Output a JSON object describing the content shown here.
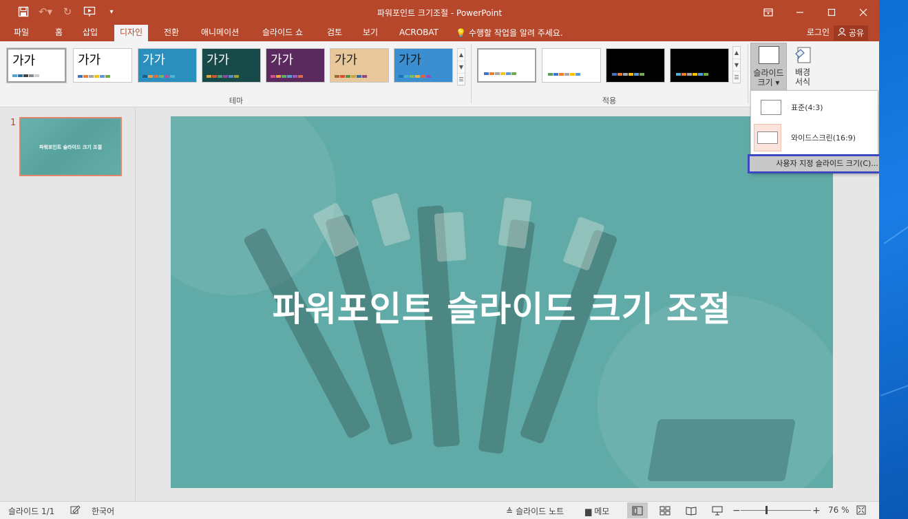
{
  "app": {
    "title": "파워포인트 크기조절 - PowerPoint",
    "accent": "#b7472a"
  },
  "qat": {
    "save_icon": "save-icon",
    "undo_icon": "undo-icon",
    "redo_icon": "redo-icon",
    "present_icon": "present-from-start-icon",
    "customize_icon": "customize-qat-icon"
  },
  "window_controls": {
    "ribbon_display": "ribbon-display-options-icon",
    "minimize": "minimize-icon",
    "maximize": "maximize-icon",
    "close": "close-icon"
  },
  "tabs": [
    {
      "label": "파일"
    },
    {
      "label": "홈"
    },
    {
      "label": "삽입"
    },
    {
      "label": "디자인"
    },
    {
      "label": "전환"
    },
    {
      "label": "애니메이션"
    },
    {
      "label": "슬라이드 쇼"
    },
    {
      "label": "검토"
    },
    {
      "label": "보기"
    },
    {
      "label": "ACROBAT"
    }
  ],
  "tell_me": "수행할 작업을 알려 주세요.",
  "login": "로그인",
  "share": "공유",
  "ribbon": {
    "themes_group_label": "테마",
    "variants_group_label": "적용",
    "themes": [
      {
        "sample": "가가",
        "bg": "#ffffff",
        "fg": "#000000",
        "colors": [
          "#5aa0c8",
          "#2e6f96",
          "#444444",
          "#888888",
          "#cccccc"
        ]
      },
      {
        "sample": "가가",
        "bg": "#ffffff",
        "fg": "#000000",
        "colors": [
          "#4472c4",
          "#ed7d31",
          "#a5a5a5",
          "#ffc000",
          "#5b9bd5",
          "#70ad47"
        ]
      },
      {
        "sample": "가가",
        "bg": "#2a8fbd",
        "fg": "#ffffff",
        "colors": [
          "#1e5f8a",
          "#f2a03d",
          "#e86b3a",
          "#6cb86a",
          "#c04d9a",
          "#4fb5d8"
        ]
      },
      {
        "sample": "가가",
        "bg": "#194a4a",
        "fg": "#ffffff",
        "colors": [
          "#d9a540",
          "#c85a3c",
          "#4d9c7a",
          "#8a4d9c",
          "#5a8cc8",
          "#a0a040"
        ]
      },
      {
        "sample": "가가",
        "bg": "#5a2a5e",
        "fg": "#ffffff",
        "colors": [
          "#d94f8e",
          "#e8a33d",
          "#5bb35b",
          "#4aa3d9",
          "#9a5cc4",
          "#e06a3c"
        ]
      },
      {
        "sample": "가가",
        "bg": "#e8c79a",
        "fg": "#222222",
        "colors": [
          "#9c6a3a",
          "#d94f3a",
          "#5a8c4a",
          "#c8a43a",
          "#3a6a9c",
          "#8a4a7a"
        ]
      },
      {
        "sample": "가가",
        "bg": "#3b8fd0",
        "fg": "#1a1a1a",
        "colors": [
          "#1e72b8",
          "#44b0c8",
          "#7ac04a",
          "#f2b33a",
          "#e8603a",
          "#9a4ab8"
        ]
      }
    ],
    "variants": [
      {
        "bg": "#ffffff",
        "colors": [
          "#4472c4",
          "#ed7d31",
          "#a5a5a5",
          "#ffc000",
          "#5b9bd5",
          "#70ad47"
        ]
      },
      {
        "bg": "#ffffff",
        "colors": [
          "#5a9e5a",
          "#4472c4",
          "#ed7d31",
          "#a5a5a5",
          "#ffc000",
          "#5b9bd5"
        ]
      },
      {
        "bg": "#000000",
        "colors": [
          "#4472c4",
          "#ed7d31",
          "#a5a5a5",
          "#ffc000",
          "#5b9bd5",
          "#70ad47"
        ]
      },
      {
        "bg": "#000000",
        "colors": [
          "#5aaad2",
          "#ed7d31",
          "#a5a5a5",
          "#ffc000",
          "#5b9bd5",
          "#70ad47"
        ]
      }
    ],
    "slide_size_label_1": "슬라이드",
    "slide_size_label_2": "크기 ▾",
    "format_bg_label_1": "배경",
    "format_bg_label_2": "서식"
  },
  "slide_size_menu": {
    "standard": "표준(4:3)",
    "widescreen": "와이드스크린(16:9)",
    "custom": "사용자 지정 슬라이드 크기(C)..."
  },
  "thumbnails": [
    {
      "number": "1",
      "title": "파워포인트 슬라이드 크기 조절"
    }
  ],
  "slide": {
    "title": "파워포인트 슬라이드 크기 조절",
    "bg": "#60aba7"
  },
  "status": {
    "slide_counter": "슬라이드 1/1",
    "language": "한국어",
    "notes": "슬라이드 노트",
    "comments": "메모",
    "zoom": "76 %",
    "zoom_minus": "−",
    "zoom_plus": "+"
  }
}
